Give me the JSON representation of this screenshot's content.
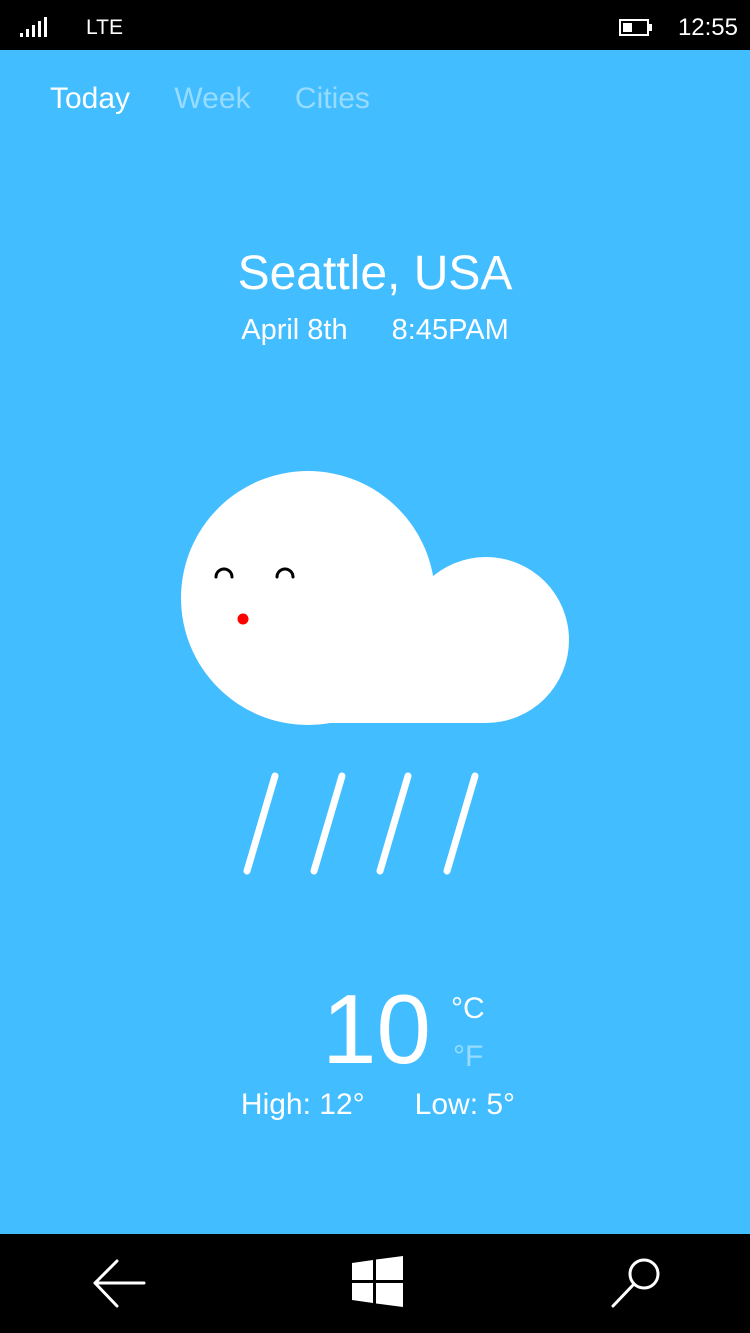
{
  "status": {
    "network": "LTE",
    "time": "12:55",
    "signal_icon": "signal-bars-icon",
    "battery_icon": "battery-icon"
  },
  "tabs": [
    {
      "label": "Today",
      "active": true
    },
    {
      "label": "Week",
      "active": false
    },
    {
      "label": "Cities",
      "active": false
    }
  ],
  "location": {
    "city": "Seattle, USA",
    "date": "April 8th",
    "time": "8:45PAM"
  },
  "weather": {
    "condition_icon": "rain-cloud-icon",
    "temperature": "10",
    "unit_celsius": "°C",
    "unit_fahrenheit": "°F",
    "selected_unit": "°C",
    "high": "High: 12°",
    "low": "Low: 5°"
  },
  "nav": {
    "back_icon": "back-arrow-icon",
    "home_icon": "windows-logo-icon",
    "search_icon": "search-icon"
  },
  "colors": {
    "background": "#42bdff",
    "cloud": "#ffffff",
    "cheek": "#ff0000",
    "system_bars": "#000000"
  }
}
